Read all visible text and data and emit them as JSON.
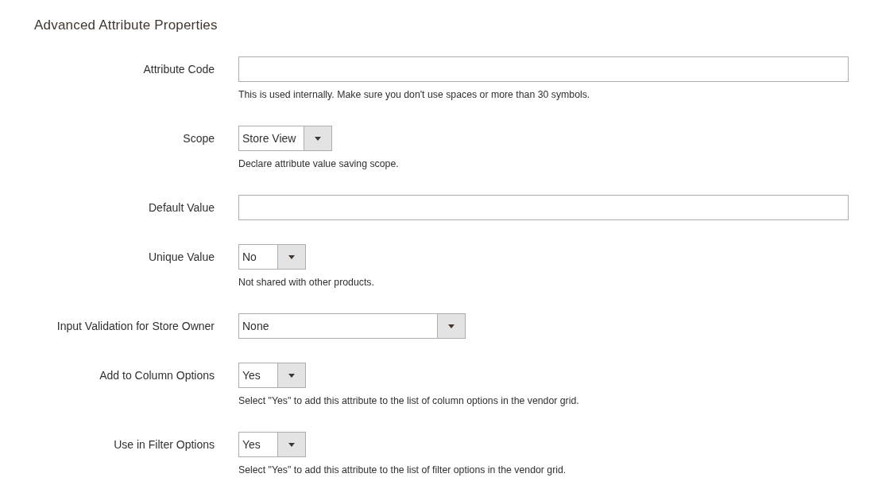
{
  "section": {
    "title": "Advanced Attribute Properties"
  },
  "fields": [
    {
      "label": "Attribute Code",
      "kind": "text",
      "note": "This is used internally. Make sure you don't use spaces or more than 30 symbols."
    },
    {
      "label": "Scope",
      "kind": "select",
      "value": "Store View",
      "note": "Declare attribute value saving scope."
    },
    {
      "label": "Default Value",
      "kind": "text"
    },
    {
      "label": "Unique Value",
      "kind": "select",
      "value": "No",
      "note": "Not shared with other products."
    },
    {
      "label": "Input Validation for Store Owner",
      "kind": "wide-select",
      "value": "None"
    },
    {
      "label": "Add to Column Options",
      "kind": "select",
      "value": "Yes",
      "note": "Select \"Yes\" to add this attribute to the list of column options in the vendor grid."
    },
    {
      "label": "Use in Filter Options",
      "kind": "select",
      "value": "Yes",
      "note": "Select \"Yes\" to add this attribute to the list of filter options in the vendor grid."
    }
  ]
}
